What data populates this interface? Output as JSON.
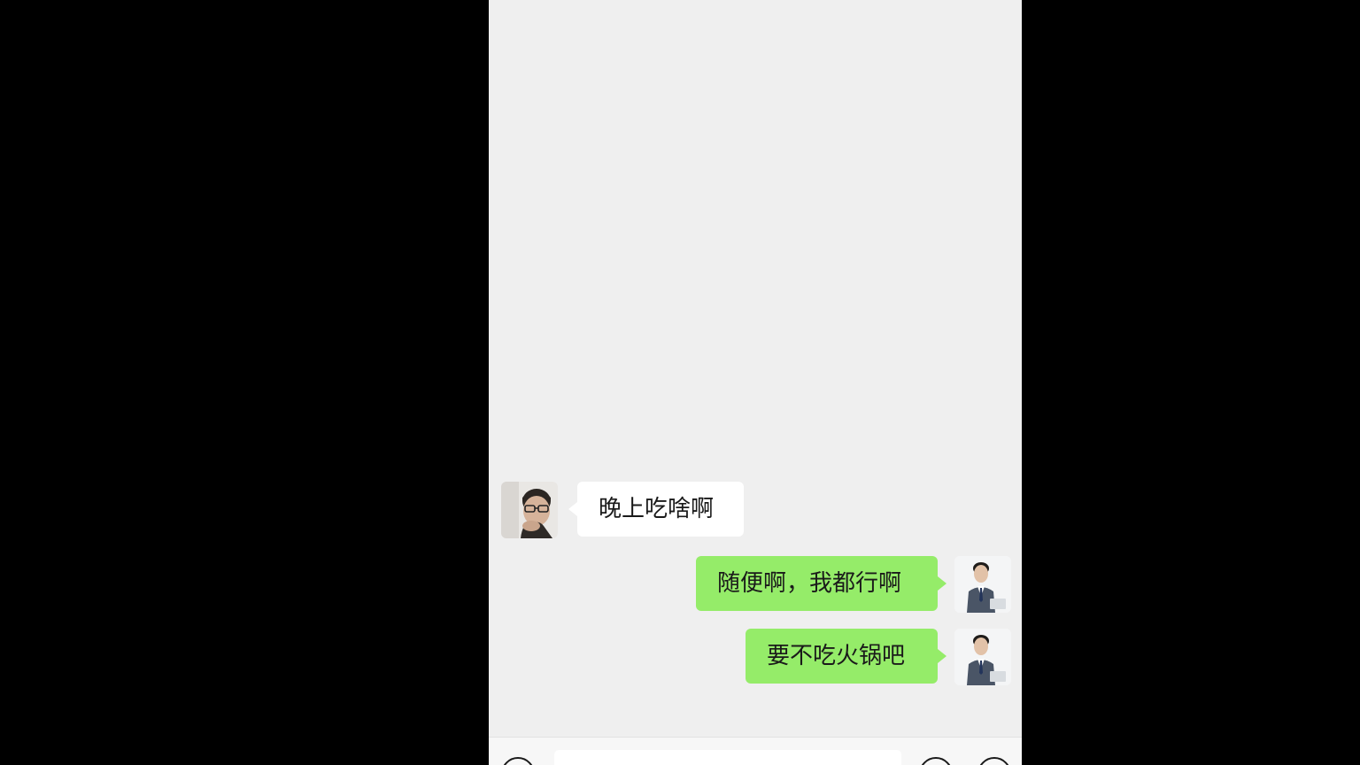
{
  "chat": {
    "messages": [
      {
        "sender": "other",
        "text": "晚上吃啥啊"
      },
      {
        "sender": "me",
        "text": "随便啊，我都行啊"
      },
      {
        "sender": "me",
        "text": "要不吃火锅吧"
      }
    ]
  },
  "input_bar": {
    "left_button_icon": "voice-icon",
    "right_button_1_icon": "emoji-icon",
    "right_button_2_icon": "add-icon",
    "message_field_value": ""
  },
  "colors": {
    "chat_background": "#efefef",
    "incoming_bubble": "#ffffff",
    "outgoing_bubble": "#95ec69",
    "letterbox": "#000000"
  }
}
